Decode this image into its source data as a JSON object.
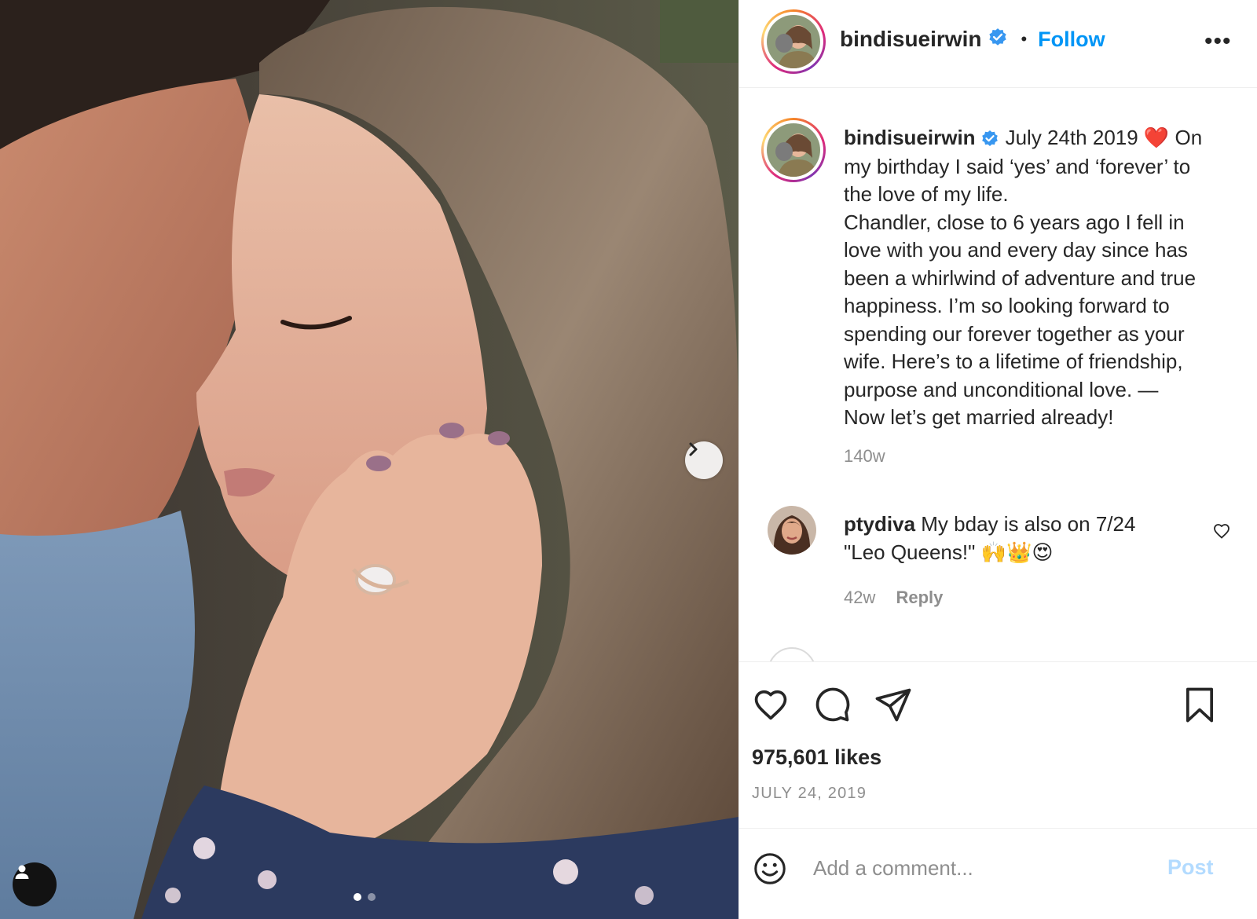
{
  "post": {
    "username": "bindisueirwin",
    "follow_label": "Follow",
    "separator": "•",
    "more_label": "•••",
    "caption_lines": [
      "July 24th 2019 ❤️ On",
      "my birthday I said ‘yes’ and ‘forever’ to",
      "the love of my life.",
      "Chandler, close to 6 years ago I fell in",
      "love with you and every day since has",
      "been a whirlwind of adventure and true",
      "happiness. I’m so looking forward to",
      "spending our forever together as your",
      "wife. Here’s to a lifetime of friendship,",
      "purpose and unconditional love. —",
      "Now let’s get married already!"
    ],
    "caption_time": "140w",
    "likes": "975,601 likes",
    "date": "JULY 24, 2019",
    "carousel": {
      "total": 2,
      "current": 1
    }
  },
  "comments": [
    {
      "username": "ptydiva",
      "text_line1": "My bday is also on 7/24",
      "text_line2": "\"Leo Queens!\" 🙌👑😍",
      "time": "42w",
      "reply_label": "Reply"
    }
  ],
  "add_comment": {
    "placeholder": "Add a comment...",
    "post_label": "Post"
  },
  "colors": {
    "link_blue": "#0095f6",
    "verified_blue": "#3897f0",
    "muted": "#8e8e8e",
    "post_disabled": "#b3dbff"
  },
  "icons": {
    "header_verified": "verified-badge-icon",
    "next": "chevron-right-icon",
    "tag": "user-tag-icon",
    "like": "heart-icon",
    "comment": "comment-bubble-icon",
    "share": "paper-plane-icon",
    "save": "bookmark-icon",
    "emoji": "smiley-icon",
    "comment_like": "small-heart-icon"
  }
}
